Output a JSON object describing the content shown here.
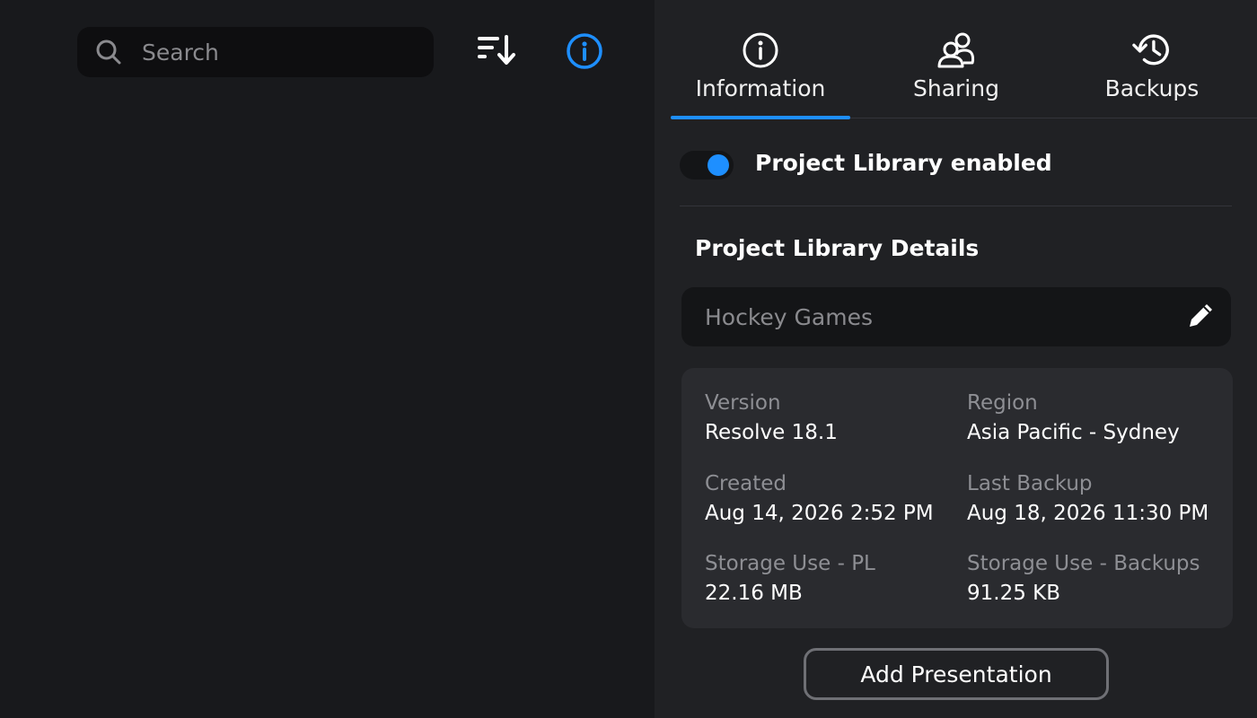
{
  "search": {
    "placeholder": "Search",
    "value": ""
  },
  "toolbar": {
    "sort_icon": "sort-descending-icon",
    "info_icon": "info-icon",
    "accent_color": "#1e8fff"
  },
  "tabs": [
    {
      "label": "Information",
      "icon": "info-icon",
      "active": true
    },
    {
      "label": "Sharing",
      "icon": "users-icon",
      "active": false
    },
    {
      "label": "Backups",
      "icon": "history-icon",
      "active": false
    }
  ],
  "library_toggle": {
    "label": "Project Library enabled",
    "enabled": true
  },
  "details": {
    "title": "Project Library Details",
    "name_value": "Hockey Games",
    "fields": {
      "version": {
        "label": "Version",
        "value": "Resolve 18.1"
      },
      "region": {
        "label": "Region",
        "value": "Asia Pacific - Sydney"
      },
      "created": {
        "label": "Created",
        "value": "Aug 14, 2026 2:52 PM"
      },
      "last_backup": {
        "label": "Last Backup",
        "value": "Aug 18, 2026 11:30 PM"
      },
      "storage_pl": {
        "label": "Storage Use - PL",
        "value": "22.16 MB"
      },
      "storage_backups": {
        "label": "Storage Use - Backups",
        "value": "91.25 KB"
      }
    }
  },
  "actions": {
    "add_presentation_label": "Add Presentation"
  }
}
